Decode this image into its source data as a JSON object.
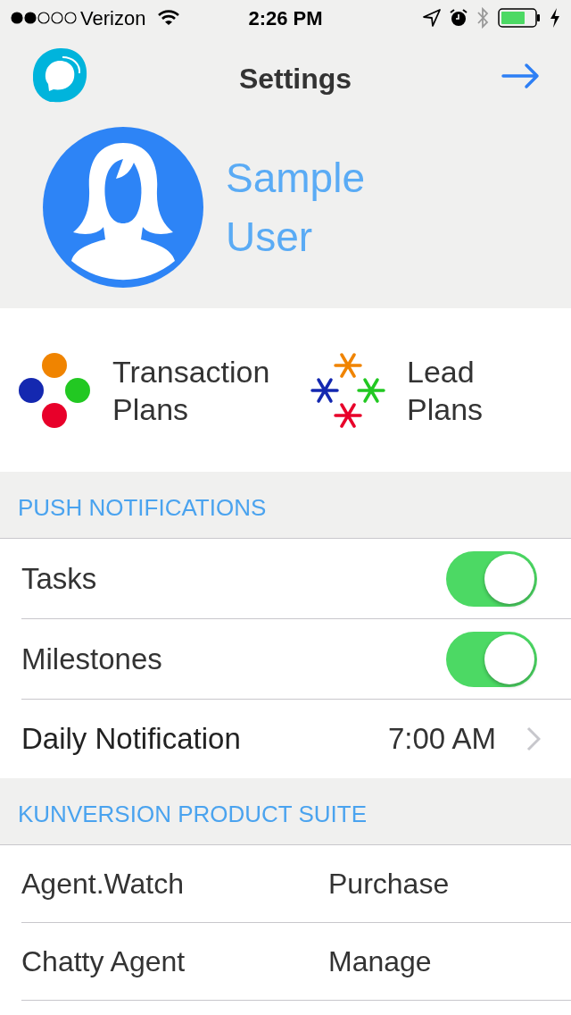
{
  "status_bar": {
    "carrier": "Verizon",
    "time": "2:26 PM"
  },
  "header": {
    "title": "Settings"
  },
  "profile": {
    "name_lines": [
      "Sample",
      "User"
    ]
  },
  "plans": [
    {
      "kind": "transaction",
      "label_lines": [
        "Transaction",
        "Plans"
      ]
    },
    {
      "kind": "lead",
      "label_lines": [
        "Lead",
        "Plans"
      ]
    }
  ],
  "sections": [
    {
      "title": "PUSH NOTIFICATIONS",
      "rows": [
        {
          "kind": "toggle",
          "label": "Tasks",
          "on": true
        },
        {
          "kind": "toggle",
          "label": "Milestones",
          "on": true
        },
        {
          "kind": "value",
          "label": "Daily Notification",
          "value": "7:00 AM"
        }
      ]
    },
    {
      "title": "KUNVERSION PRODUCT SUITE",
      "rows": [
        {
          "kind": "action",
          "label": "Agent.Watch",
          "action": "Purchase"
        },
        {
          "kind": "action",
          "label": "Chatty Agent",
          "action": "Manage"
        }
      ]
    }
  ]
}
